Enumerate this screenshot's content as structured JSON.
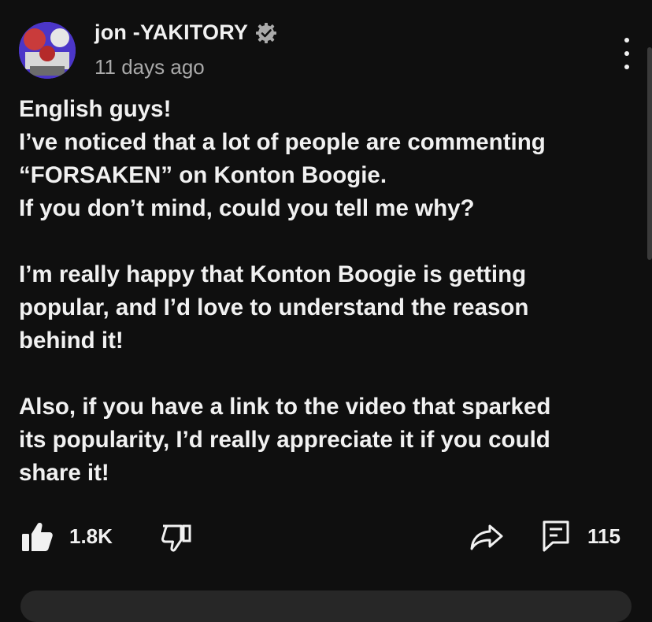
{
  "comment": {
    "author": "jon -YAKITORY",
    "verified_icon": "verified-gear-badge-icon",
    "timestamp": "11 days ago",
    "more_icon": "more-vertical-icon",
    "lines": [
      "English guys!",
      "I’ve noticed that a lot of people are commenting",
      "“FORSAKEN” on Konton Boogie.",
      "If you don’t mind, could you tell me why?",
      "",
      "I’m really happy that Konton Boogie is getting",
      "popular, and I’d love to understand the reason",
      "behind it!",
      "",
      "Also, if you have a link to the video that sparked",
      "its popularity, I’d really appreciate it if you could",
      "share it!"
    ]
  },
  "actions": {
    "like_icon": "thumbs-up-filled-icon",
    "like_count": "1.8K",
    "dislike_icon": "thumbs-down-outline-icon",
    "share_icon": "share-arrow-icon",
    "reply_icon": "comment-reply-icon",
    "reply_count": "115"
  },
  "colors": {
    "background": "#0f0f0f",
    "text": "#f1f1f1",
    "secondary_text": "#aaaaaa",
    "avatar_bg": "#5b3fd6"
  }
}
